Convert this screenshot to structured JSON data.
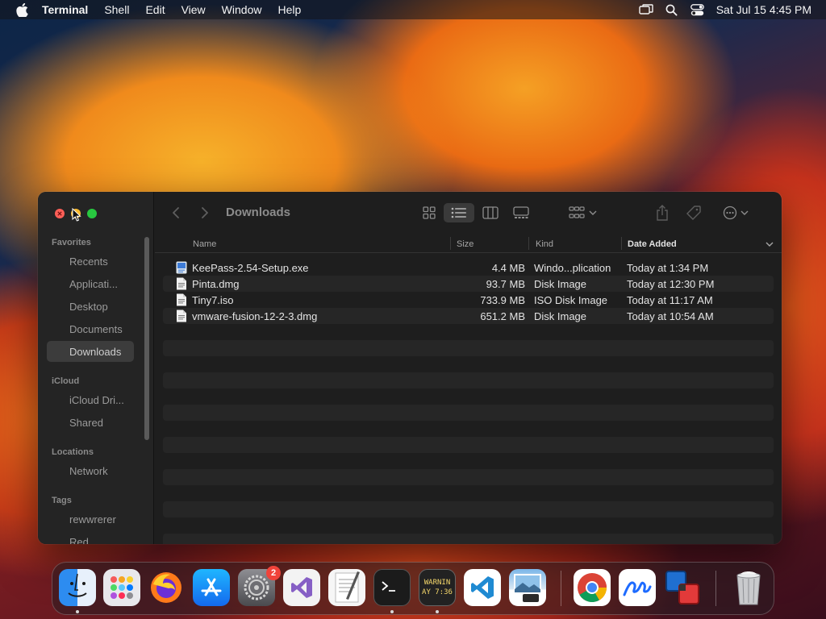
{
  "menubar": {
    "app_name": "Terminal",
    "menus": [
      "Shell",
      "Edit",
      "View",
      "Window",
      "Help"
    ],
    "clock": "Sat Jul 15  4:45 PM"
  },
  "finder": {
    "title": "Downloads",
    "sidebar": {
      "favorites_header": "Favorites",
      "favorites": [
        "Recents",
        "Applicati...",
        "Desktop",
        "Documents",
        "Downloads"
      ],
      "icloud_header": "iCloud",
      "icloud": [
        "iCloud Dri...",
        "Shared"
      ],
      "locations_header": "Locations",
      "locations": [
        "Network"
      ],
      "tags_header": "Tags",
      "tags": [
        "rewwrerer",
        "Red"
      ],
      "selected": "Downloads"
    },
    "columns": {
      "name": "Name",
      "size": "Size",
      "kind": "Kind",
      "date": "Date Added"
    },
    "files": [
      {
        "name": "KeePass-2.54-Setup.exe",
        "size": "4.4 MB",
        "kind": "Windo...plication",
        "date": "Today at 1:34 PM"
      },
      {
        "name": "Pinta.dmg",
        "size": "93.7 MB",
        "kind": "Disk Image",
        "date": "Today at 12:30 PM"
      },
      {
        "name": "Tiny7.iso",
        "size": "733.9 MB",
        "kind": "ISO Disk Image",
        "date": "Today at 11:17 AM"
      },
      {
        "name": "vmware-fusion-12-2-3.dmg",
        "size": "651.2 MB",
        "kind": "Disk Image",
        "date": "Today at 10:54 AM"
      }
    ]
  },
  "dock": {
    "apps": [
      "Finder",
      "Launchpad",
      "Firefox",
      "App Store",
      "System Settings",
      "Visual Studio",
      "TextEdit",
      "Terminal",
      "Console",
      "Visual Studio Code",
      "Preview",
      "Google Chrome",
      "Freeform",
      "VMware Fusion",
      "Trash"
    ],
    "settings_badge": "2",
    "console_text_line1": "WARNIN",
    "console_text_line2": "AY 7:36"
  },
  "colors": {
    "accent_close": "#fe5f57",
    "accent_min": "#febc2e",
    "accent_zoom": "#28c840",
    "window_bg": "#1e1e1e"
  }
}
